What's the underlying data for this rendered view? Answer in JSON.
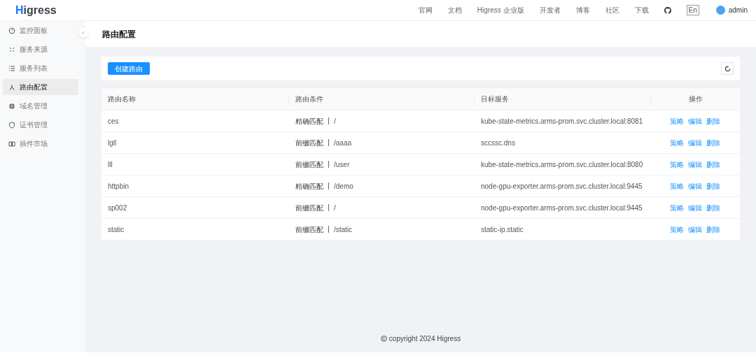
{
  "header": {
    "logo": "Higress",
    "nav": [
      "官网",
      "文档",
      "Higress 企业版",
      "开发者",
      "博客",
      "社区",
      "下载"
    ],
    "language": "En",
    "user": "admin"
  },
  "sidebar": {
    "items": [
      {
        "label": "监控面板",
        "selected": false
      },
      {
        "label": "服务来源",
        "selected": false
      },
      {
        "label": "服务列表",
        "selected": false
      },
      {
        "label": "路由配置",
        "selected": true
      },
      {
        "label": "域名管理",
        "selected": false
      },
      {
        "label": "证书管理",
        "selected": false
      },
      {
        "label": "插件市场",
        "selected": false
      }
    ]
  },
  "page_title": "路由配置",
  "create_button": "创建路由",
  "table": {
    "columns": [
      "路由名称",
      "路由条件",
      "目标服务",
      "操作"
    ],
    "rows": [
      {
        "name": "ces",
        "match": "精确匹配",
        "path": "/",
        "target": "kube-state-metrics.arms-prom.svc.cluster.local:8081",
        "actions": [
          "策略",
          "编辑",
          "删除"
        ]
      },
      {
        "name": "lgll",
        "match": "前缀匹配",
        "path": "/aaaa",
        "target": "sccssc.dns",
        "actions": [
          "策略",
          "编辑",
          "删除"
        ]
      },
      {
        "name": "lll",
        "match": "前缀匹配",
        "path": "/user",
        "target": "kube-state-metrics.arms-prom.svc.cluster.local:8080",
        "actions": [
          "策略",
          "编辑",
          "删除"
        ]
      },
      {
        "name": "httpbin",
        "match": "精确匹配",
        "path": "/demo",
        "target": "node-gpu-exporter.arms-prom.svc.cluster.local:9445",
        "actions": [
          "策略",
          "编辑",
          "删除"
        ]
      },
      {
        "name": "sp002",
        "match": "前缀匹配",
        "path": "/",
        "target": "node-gpu-exporter.arms-prom.svc.cluster.local:9445",
        "actions": [
          "策略",
          "编辑",
          "删除"
        ]
      },
      {
        "name": "static",
        "match": "前缀匹配",
        "path": "/static",
        "target": "static-ip.static",
        "actions": [
          "策略",
          "编辑",
          "删除"
        ]
      }
    ]
  },
  "footer": "copyright 2024 Higress"
}
